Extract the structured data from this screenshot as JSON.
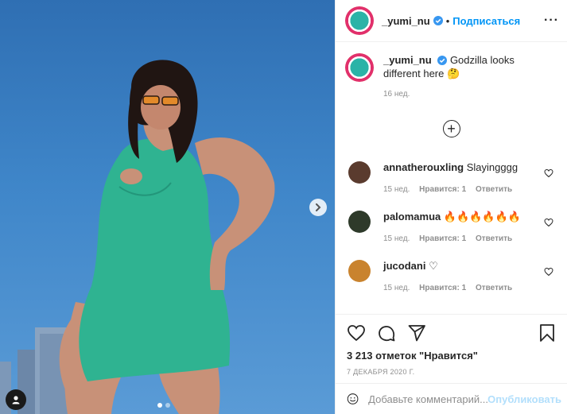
{
  "post": {
    "username": "_yumi_nu",
    "follow_label": "Подписаться",
    "separator": "•",
    "more_label": "···",
    "caption_text": "Godzilla looks different here 🤔",
    "caption_time": "16 нед.",
    "image_count": 2,
    "active_image": 1
  },
  "comments": [
    {
      "user": "annatherouxling",
      "text": "Slayingggg",
      "time": "15 нед.",
      "likes": "Нравится: 1",
      "reply": "Ответить",
      "avatar_color": "#5a3b2e"
    },
    {
      "user": "palomamua",
      "text": "🔥🔥🔥🔥🔥🔥",
      "time": "15 нед.",
      "likes": "Нравится: 1",
      "reply": "Ответить",
      "avatar_color": "#2e3a2a"
    },
    {
      "user": "jucodani",
      "text": "♡",
      "time": "15 нед.",
      "likes": "Нравится: 1",
      "reply": "Ответить",
      "avatar_color": "#c9832e"
    }
  ],
  "actions": {
    "likes_text": "3 213 отметок \"Нравится\"",
    "date_text": "7 ДЕКАБРЯ 2020 Г."
  },
  "add_comment": {
    "placeholder": "Добавьте комментарий...",
    "post_label": "Опубликовать"
  },
  "icons": {
    "verified": "verified-badge-icon",
    "like": "heart-icon",
    "comment": "comment-icon",
    "share": "send-icon",
    "save": "bookmark-icon",
    "emoji": "emoji-icon",
    "load_more": "plus-circle-icon",
    "next": "chevron-right-icon",
    "tag": "user-tag-icon"
  },
  "colors": {
    "accent": "#0095f6",
    "muted": "#8e8e8e",
    "post_disabled": "#b2dffc",
    "dress": "#2bb38f",
    "sky": "#3f86c9"
  }
}
